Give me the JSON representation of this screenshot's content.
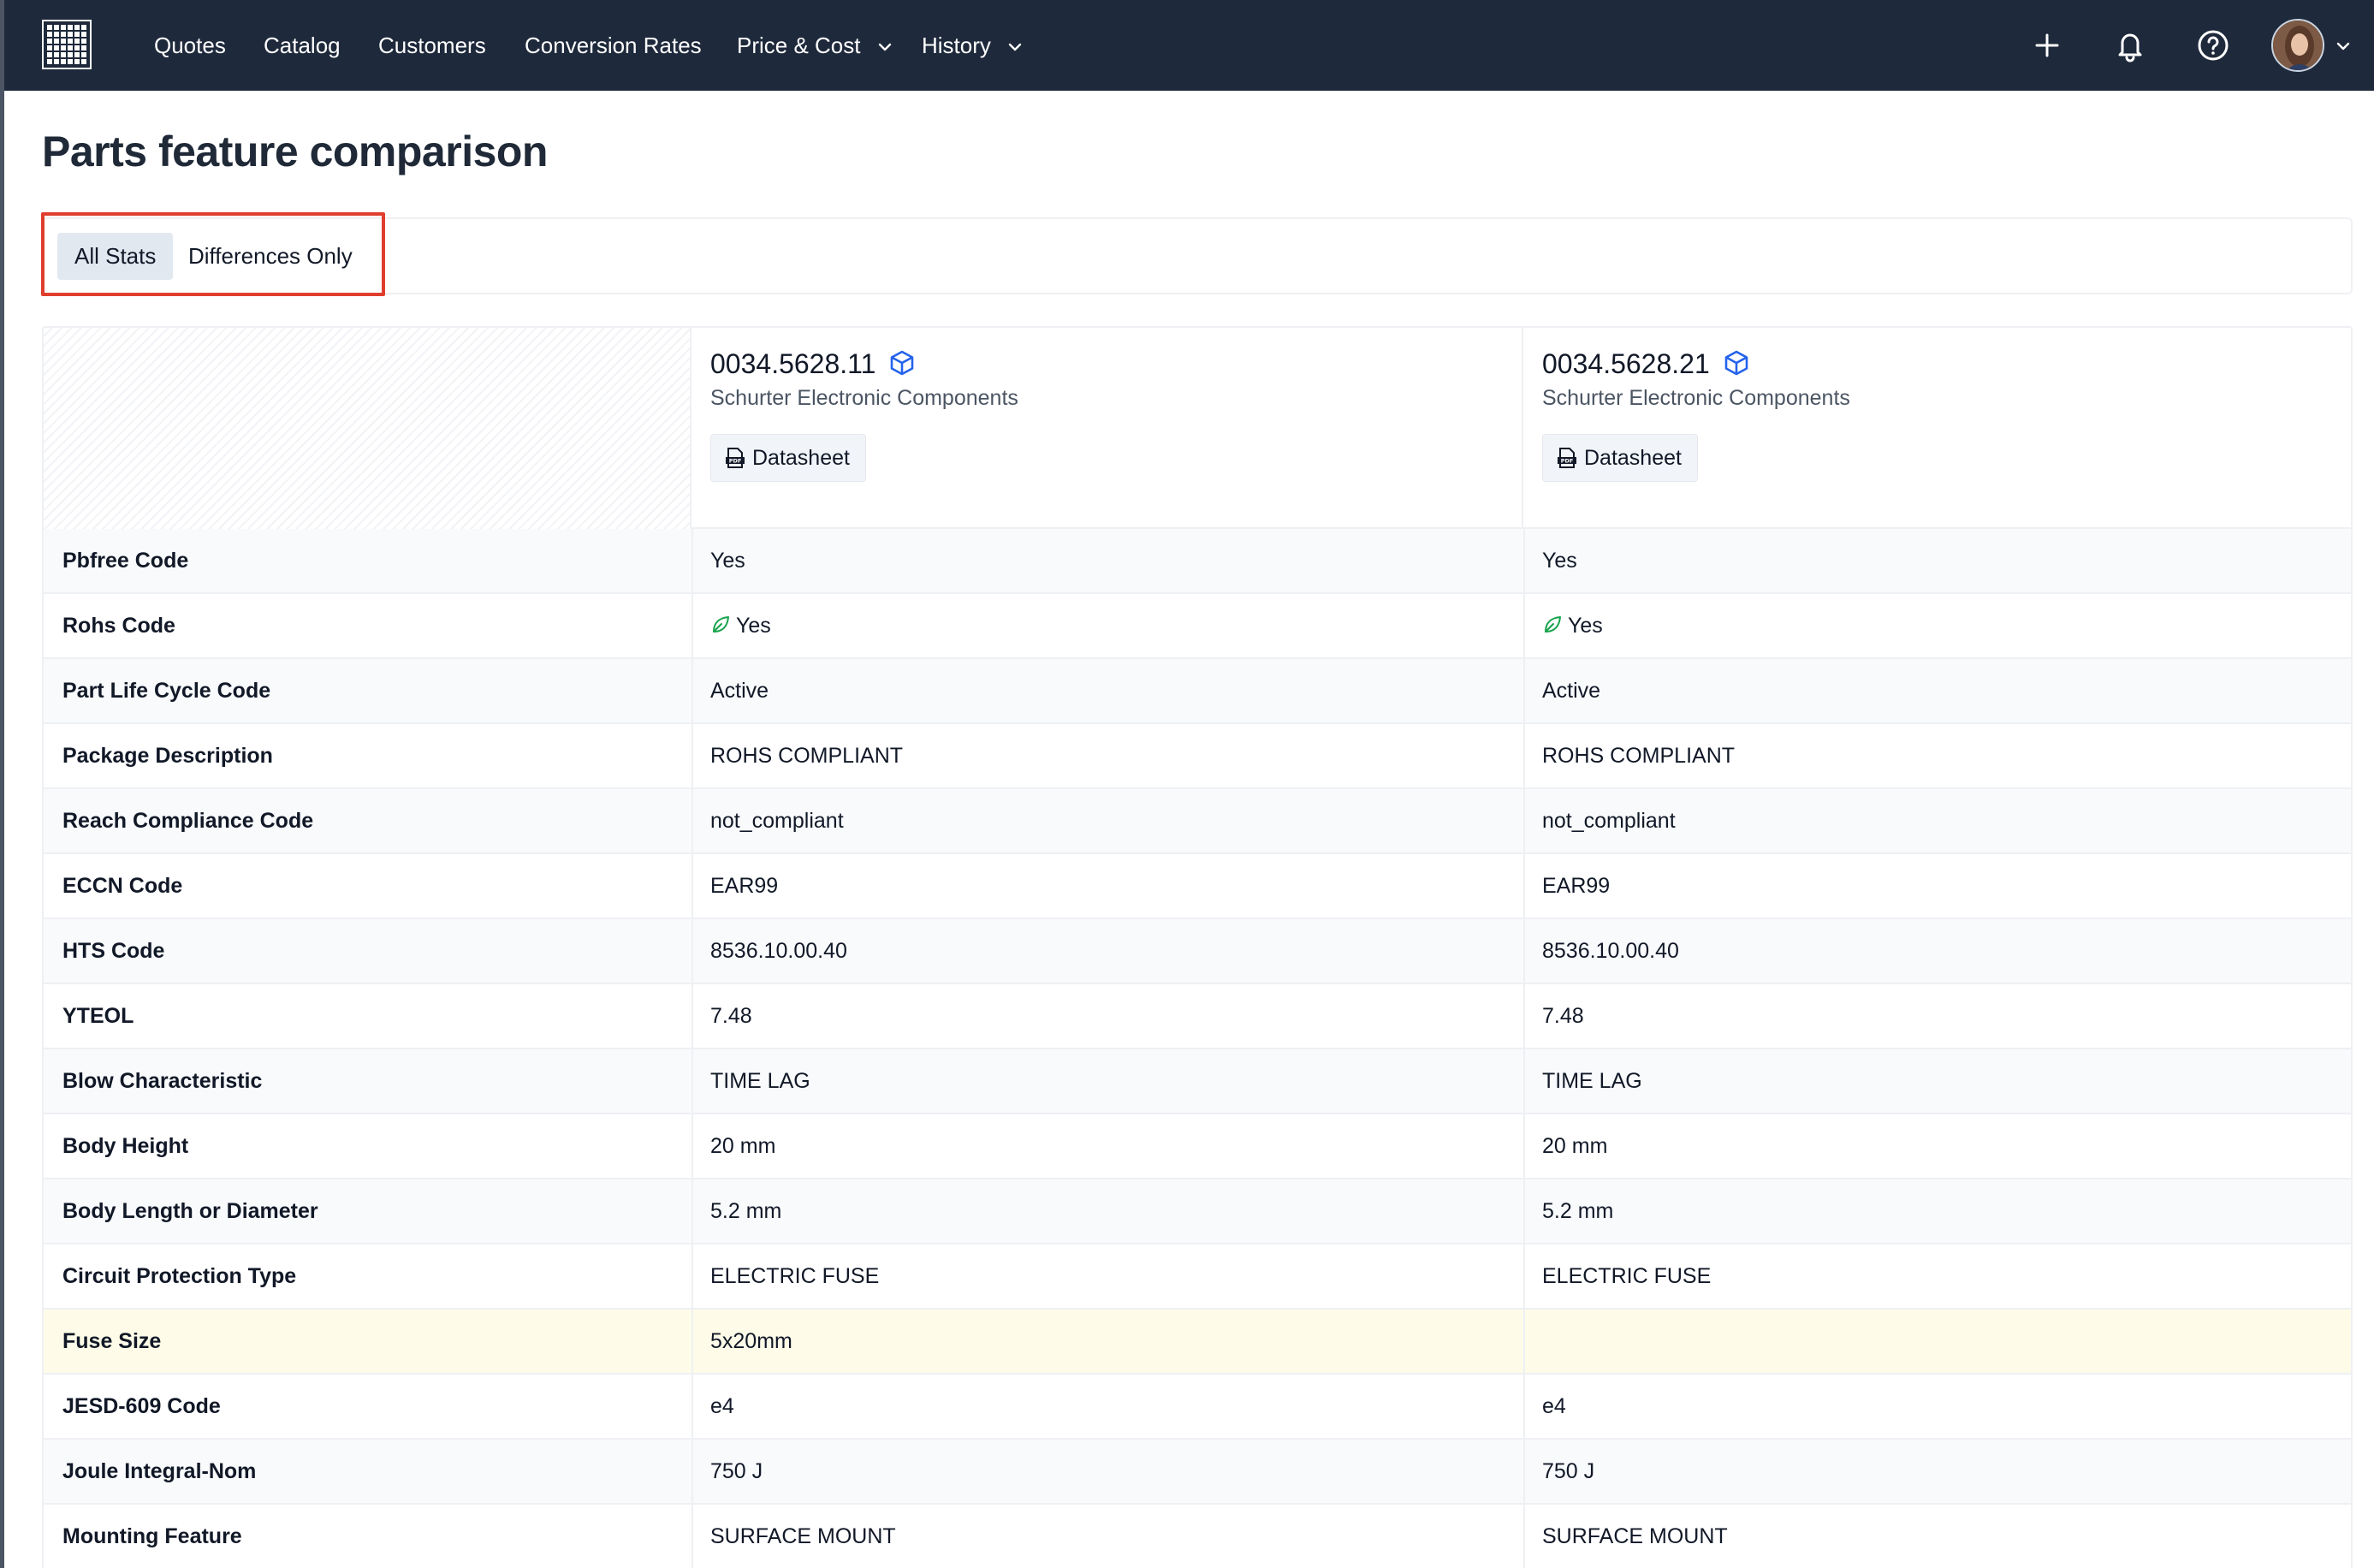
{
  "nav": {
    "items": [
      {
        "label": "Quotes",
        "has_menu": false
      },
      {
        "label": "Catalog",
        "has_menu": false
      },
      {
        "label": "Customers",
        "has_menu": false
      },
      {
        "label": "Conversion Rates",
        "has_menu": false
      },
      {
        "label": "Price & Cost",
        "has_menu": true
      },
      {
        "label": "History",
        "has_menu": true
      }
    ],
    "icons": [
      "plus-icon",
      "bell-icon",
      "help-icon"
    ]
  },
  "page": {
    "title": "Parts feature comparison"
  },
  "toggle": {
    "all_label": "All Stats",
    "diff_label": "Differences Only",
    "selected": "All Stats"
  },
  "parts": [
    {
      "number": "0034.5628.11",
      "manufacturer": "Schurter Electronic Components",
      "datasheet_label": "Datasheet"
    },
    {
      "number": "0034.5628.21",
      "manufacturer": "Schurter Electronic Components",
      "datasheet_label": "Datasheet"
    }
  ],
  "rows": [
    {
      "label": "Pbfree Code",
      "values": [
        "Yes",
        "Yes"
      ]
    },
    {
      "label": "Rohs Code",
      "values": [
        "Yes",
        "Yes"
      ],
      "icon": "leaf-icon"
    },
    {
      "label": "Part Life Cycle Code",
      "values": [
        "Active",
        "Active"
      ]
    },
    {
      "label": "Package Description",
      "values": [
        "ROHS COMPLIANT",
        "ROHS COMPLIANT"
      ]
    },
    {
      "label": "Reach Compliance Code",
      "values": [
        "not_compliant",
        "not_compliant"
      ]
    },
    {
      "label": "ECCN Code",
      "values": [
        "EAR99",
        "EAR99"
      ]
    },
    {
      "label": "HTS Code",
      "values": [
        "8536.10.00.40",
        "8536.10.00.40"
      ]
    },
    {
      "label": "YTEOL",
      "values": [
        "7.48",
        "7.48"
      ]
    },
    {
      "label": "Blow Characteristic",
      "values": [
        "TIME LAG",
        "TIME LAG"
      ]
    },
    {
      "label": "Body Height",
      "values": [
        "20 mm",
        "20 mm"
      ]
    },
    {
      "label": "Body Length or Diameter",
      "values": [
        "5.2 mm",
        "5.2 mm"
      ]
    },
    {
      "label": "Circuit Protection Type",
      "values": [
        "ELECTRIC FUSE",
        "ELECTRIC FUSE"
      ]
    },
    {
      "label": "Fuse Size",
      "values": [
        "5x20mm",
        ""
      ],
      "difference": true
    },
    {
      "label": "JESD-609 Code",
      "values": [
        "e4",
        "e4"
      ]
    },
    {
      "label": "Joule Integral-Nom",
      "values": [
        "750 J",
        "750 J"
      ]
    },
    {
      "label": "Mounting Feature",
      "values": [
        "SURFACE MOUNT",
        "SURFACE MOUNT"
      ]
    }
  ],
  "colors": {
    "nav_bg": "#1e293b",
    "accent_blue": "#2563eb",
    "highlight_red": "#e03e2d",
    "diff_row": "#fefce8",
    "leaf_green": "#16a34a"
  }
}
